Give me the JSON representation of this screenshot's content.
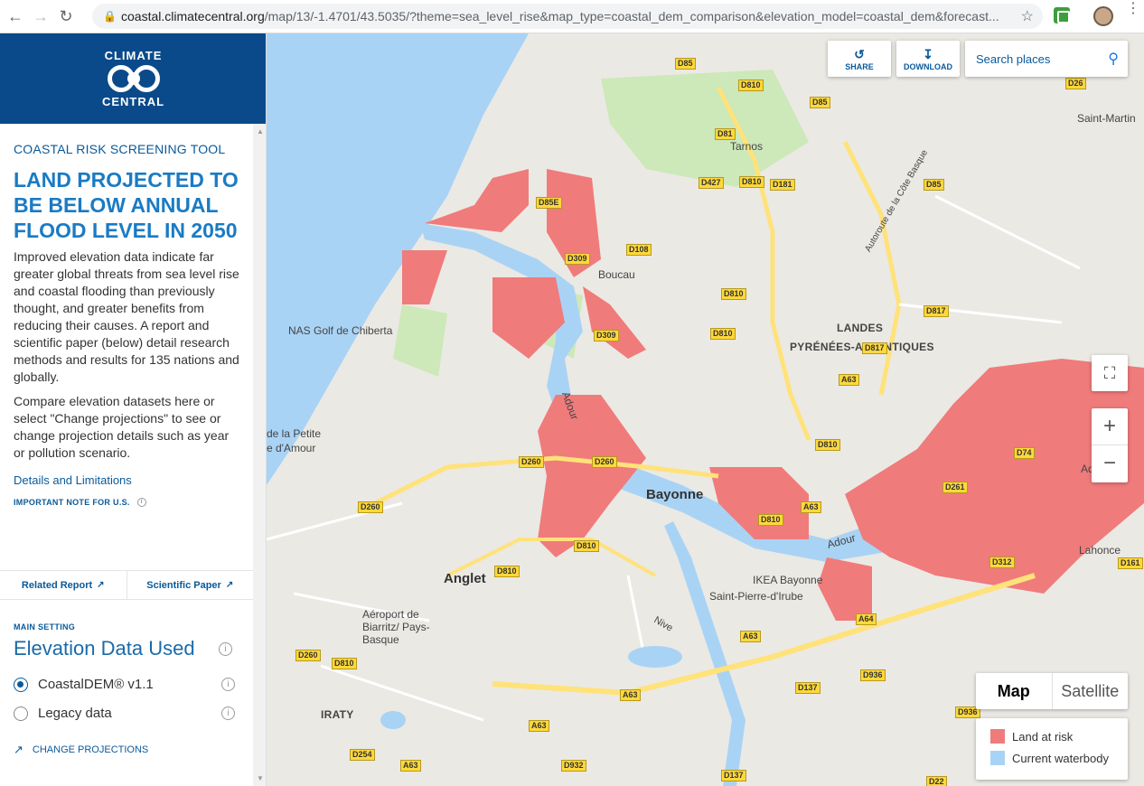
{
  "browser": {
    "url_host": "coastal.climatecentral.org",
    "url_path": "/map/13/-1.4701/43.5035/?theme=sea_level_rise&map_type=coastal_dem_comparison&elevation_model=coastal_dem&forecast...",
    "back_icon": "arrow-left-icon",
    "forward_icon": "arrow-right-icon",
    "reload_icon": "reload-icon"
  },
  "brand": {
    "line1": "CLIMATE",
    "line2": "CENTRAL"
  },
  "sidebar": {
    "tool_label": "COASTAL RISK SCREENING TOOL",
    "headline": "LAND PROJECTED TO BE BELOW ANNUAL FLOOD LEVEL IN 2050",
    "paragraph1": "Improved elevation data indicate far greater global threats from sea level rise and coastal flooding than previously thought, and greater benefits from reducing their causes. A report and scientific paper (below) detail research methods and results for 135 nations and globally.",
    "paragraph2": "Compare elevation datasets here or select \"Change projections\" to see or change projection details such as year or pollution scenario.",
    "details_link": "Details and Limitations",
    "important_note": "IMPORTANT NOTE FOR U.S.",
    "related_report": "Related Report",
    "scientific_paper": "Scientific Paper",
    "main_setting": "MAIN SETTING",
    "setting_title": "Elevation Data Used",
    "options": [
      {
        "label": "CoastalDEM® v1.1",
        "selected": true
      },
      {
        "label": "Legacy data",
        "selected": false
      }
    ],
    "change_projections": "CHANGE PROJECTIONS"
  },
  "map": {
    "share_label": "SHARE",
    "download_label": "DOWNLOAD",
    "search_placeholder": "Search places",
    "map_type_options": [
      "Map",
      "Satellite"
    ],
    "legend": [
      {
        "label": "Land at risk",
        "color": "#f07b7b"
      },
      {
        "label": "Current waterbody",
        "color": "#a9d3f5"
      }
    ],
    "places": {
      "tarnos": "Tarnos",
      "boucau": "Boucau",
      "bayonne": "Bayonne",
      "anglet": "Anglet",
      "golf": "NAS Golf de Chiberta",
      "landes": "LANDES",
      "pyrenees": "PYRÉNÉES-ATLANTIQUES",
      "ikea": "IKEA Bayonne",
      "st_pierre": "Saint-Pierre-d'Irube",
      "aeroport": "Aéroport de Biarritz/ Pays-Basque",
      "iraty": "IRATY",
      "lahonce": "Lahonce",
      "saint_martin": "Saint-Martin",
      "adour1": "Adour",
      "adour2": "Adour",
      "adour3": "Adour",
      "petite": "de la Petite",
      "damour": "e d'Amour",
      "autoroute": "Autoroute de la Côte Basque",
      "nive": "Nive"
    },
    "roads": [
      "D85",
      "D810",
      "D85",
      "D81",
      "D427",
      "D810",
      "D181",
      "D85",
      "D85E",
      "D108",
      "D309",
      "D810",
      "D309",
      "D810",
      "D817",
      "D817",
      "A63",
      "D810",
      "D74",
      "D260",
      "D260",
      "D260",
      "D261",
      "A63",
      "D810",
      "D810",
      "D810",
      "D312",
      "A64",
      "A63",
      "D260",
      "D810",
      "D936",
      "D137",
      "A63",
      "A63",
      "D254",
      "A63",
      "D932",
      "D137",
      "D936",
      "D22",
      "D161",
      "D26"
    ]
  }
}
